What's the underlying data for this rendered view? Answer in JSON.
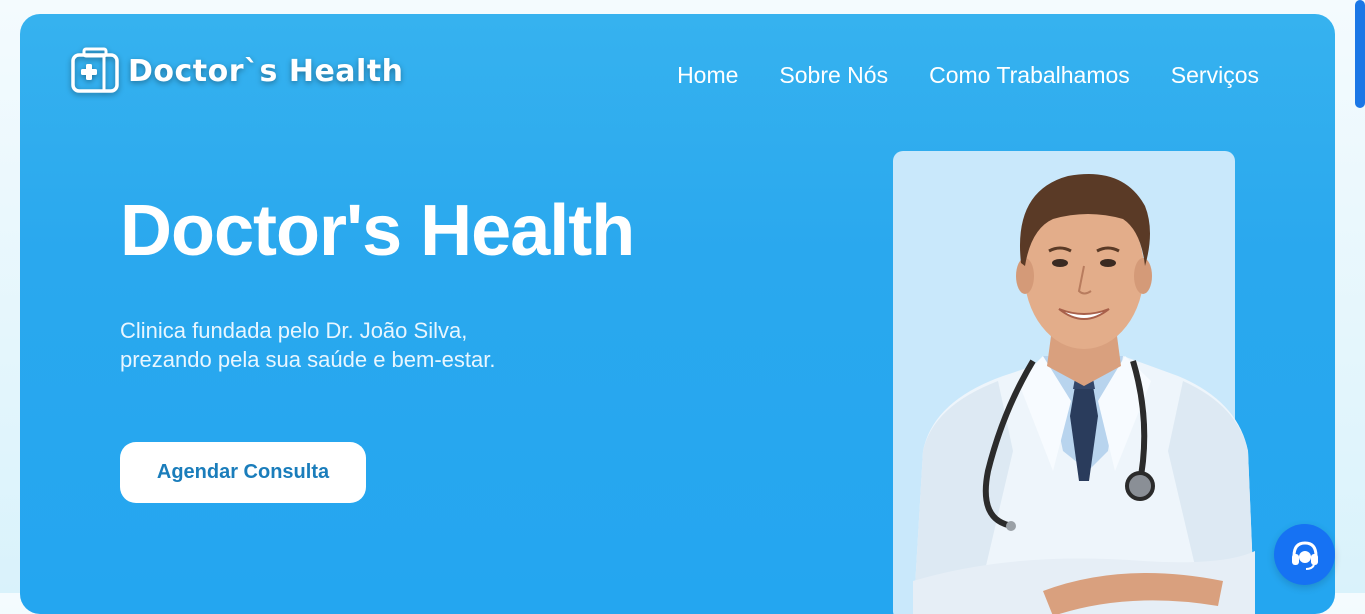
{
  "brand": {
    "name": "Doctor`s Health",
    "icon": "medical-kit-icon"
  },
  "nav": {
    "items": [
      {
        "label": "Home"
      },
      {
        "label": "Sobre Nós"
      },
      {
        "label": "Como Trabalhamos"
      },
      {
        "label": "Serviços"
      }
    ]
  },
  "hero": {
    "title": "Doctor's Health",
    "subtitle": "Clinica fundada pelo Dr. João Silva, prezando pela sua saúde e bem-estar.",
    "cta_label": "Agendar Consulta",
    "image": "doctor-portrait"
  },
  "support": {
    "icon": "headset-icon"
  },
  "colors": {
    "hero_background": "#2aa8ee",
    "cta_text": "#1a7dbb",
    "support_button": "#1672f3",
    "photo_background": "#c9e8fb"
  }
}
